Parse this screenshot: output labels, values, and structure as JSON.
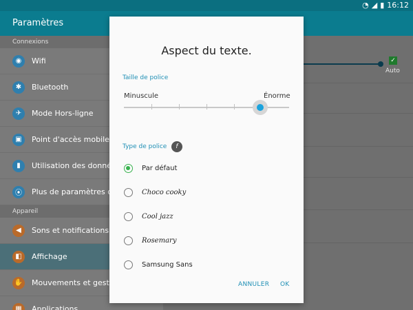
{
  "status": {
    "time": "16:12"
  },
  "appbar": {
    "title": "Paramètres"
  },
  "left": {
    "sections": [
      {
        "header": "Connexions",
        "items": [
          {
            "label": "Wifi",
            "icon": "wifi-icon",
            "glyph": "◉"
          },
          {
            "label": "Bluetooth",
            "icon": "bluetooth-icon",
            "glyph": "✱"
          },
          {
            "label": "Mode Hors-ligne",
            "icon": "airplane-icon",
            "glyph": "✈"
          },
          {
            "label": "Point d'accès mobile et",
            "icon": "hotspot-icon",
            "glyph": "▣"
          },
          {
            "label": "Utilisation des données",
            "icon": "data-usage-icon",
            "glyph": "▮"
          },
          {
            "label": "Plus de paramètres de c",
            "icon": "more-connection-icon",
            "glyph": "⦿"
          }
        ]
      },
      {
        "header": "Appareil",
        "items": [
          {
            "label": "Sons et notifications",
            "icon": "sound-icon",
            "glyph": "◀"
          },
          {
            "label": "Affichage",
            "icon": "display-icon",
            "glyph": "◧",
            "active": true
          },
          {
            "label": "Mouvements et gestes",
            "icon": "motion-icon",
            "glyph": "✋"
          },
          {
            "label": "Applications",
            "icon": "apps-icon",
            "glyph": "▦"
          }
        ]
      }
    ]
  },
  "right": {
    "auto_label": "Auto"
  },
  "dialog": {
    "title": "Aspect du texte.",
    "size_header": "Taille de police",
    "size_min": "Minuscule",
    "size_max": "Énorme",
    "size_level": 0.83,
    "font_header": "Type de police",
    "font_badge": "f",
    "options": [
      {
        "label": "Par défaut",
        "selected": true
      },
      {
        "label": "Choco cooky",
        "selected": false
      },
      {
        "label": "Cool jazz",
        "selected": false
      },
      {
        "label": "Rosemary",
        "selected": false
      },
      {
        "label": "Samsung Sans",
        "selected": false
      }
    ],
    "cancel": "ANNULER",
    "ok": "OK"
  },
  "colors": {
    "accent": "#1f8fb5",
    "radio_selected": "#37b24d",
    "slider_thumb": "#1ca3dd",
    "appbar": "#0b7c8f"
  }
}
